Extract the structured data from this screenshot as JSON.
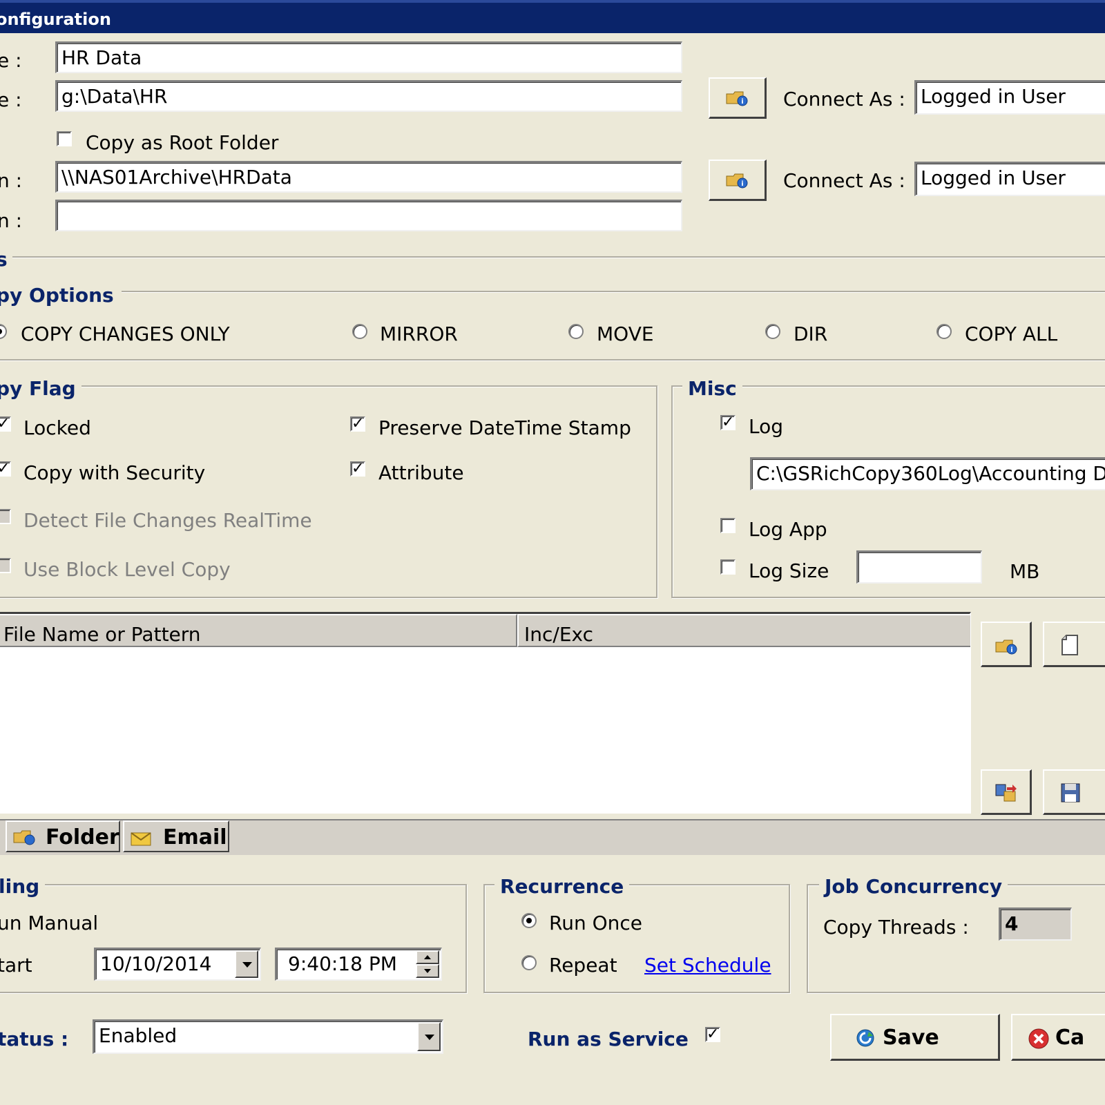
{
  "window": {
    "title": "onfiguration"
  },
  "general": {
    "name_label": "e :",
    "name_value": "HR Data",
    "source_label": "e :",
    "source_value": "g:\\Data\\HR",
    "copy_root_label": "Copy as Root Folder",
    "dest_label": "n :",
    "dest_value": "\\\\NAS01Archive\\HRData",
    "dest2_label": "n :",
    "dest2_value": "",
    "connect_as_label": "Connect As :",
    "connect_as_source": "Logged in User",
    "connect_as_dest": "Logged in User"
  },
  "options_header": "s",
  "copy_options": {
    "title": "py Options",
    "items": [
      {
        "label": "COPY CHANGES ONLY",
        "selected": true
      },
      {
        "label": "MIRROR",
        "selected": false
      },
      {
        "label": "MOVE",
        "selected": false
      },
      {
        "label": "DIR",
        "selected": false
      },
      {
        "label": "COPY ALL",
        "selected": false
      }
    ]
  },
  "copy_flag": {
    "title": "py Flag",
    "locked": "Locked",
    "copy_security": "Copy with Security",
    "detect_changes": "Detect File Changes RealTime",
    "block_level": "Use Block Level Copy",
    "preserve_datetime": "Preserve DateTime Stamp",
    "attribute": "Attribute"
  },
  "misc": {
    "title": "Misc",
    "log": "Log",
    "log_path": "C:\\GSRichCopy360Log\\Accounting D",
    "log_app": "Log App",
    "log_size": "Log Size",
    "log_size_value": "",
    "log_size_unit": "MB"
  },
  "filter_table": {
    "columns": [
      "File Name or Pattern",
      "Inc/Exc"
    ]
  },
  "tabs": [
    {
      "label": "Folder",
      "icon": "folder-icon"
    },
    {
      "label": "Email",
      "icon": "email-icon"
    }
  ],
  "scheduling": {
    "title": "ling",
    "run_manual": "un Manual",
    "start_label": "tart",
    "start_date": "10/10/2014",
    "start_time": "9:40:18 PM"
  },
  "recurrence": {
    "title": "Recurrence",
    "run_once": "Run Once",
    "repeat": "Repeat",
    "set_schedule": "Set Schedule"
  },
  "concurrency": {
    "title": "Job Concurrency",
    "threads_label": "Copy Threads :",
    "threads_value": "4"
  },
  "footer": {
    "status_label": "tatus :",
    "status_value": "Enabled",
    "run_as_service": "Run as Service",
    "save": "Save",
    "cancel": "Ca"
  }
}
